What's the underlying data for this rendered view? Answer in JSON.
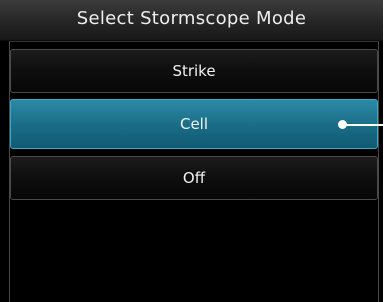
{
  "dialog": {
    "title": "Select Stormscope Mode",
    "options": [
      {
        "label": "Strike",
        "selected": false
      },
      {
        "label": "Cell",
        "selected": true
      },
      {
        "label": "Off",
        "selected": false
      }
    ]
  },
  "colors": {
    "background": "#000000",
    "selected_option": "#1b6e88",
    "text": "#f2f2f2"
  }
}
